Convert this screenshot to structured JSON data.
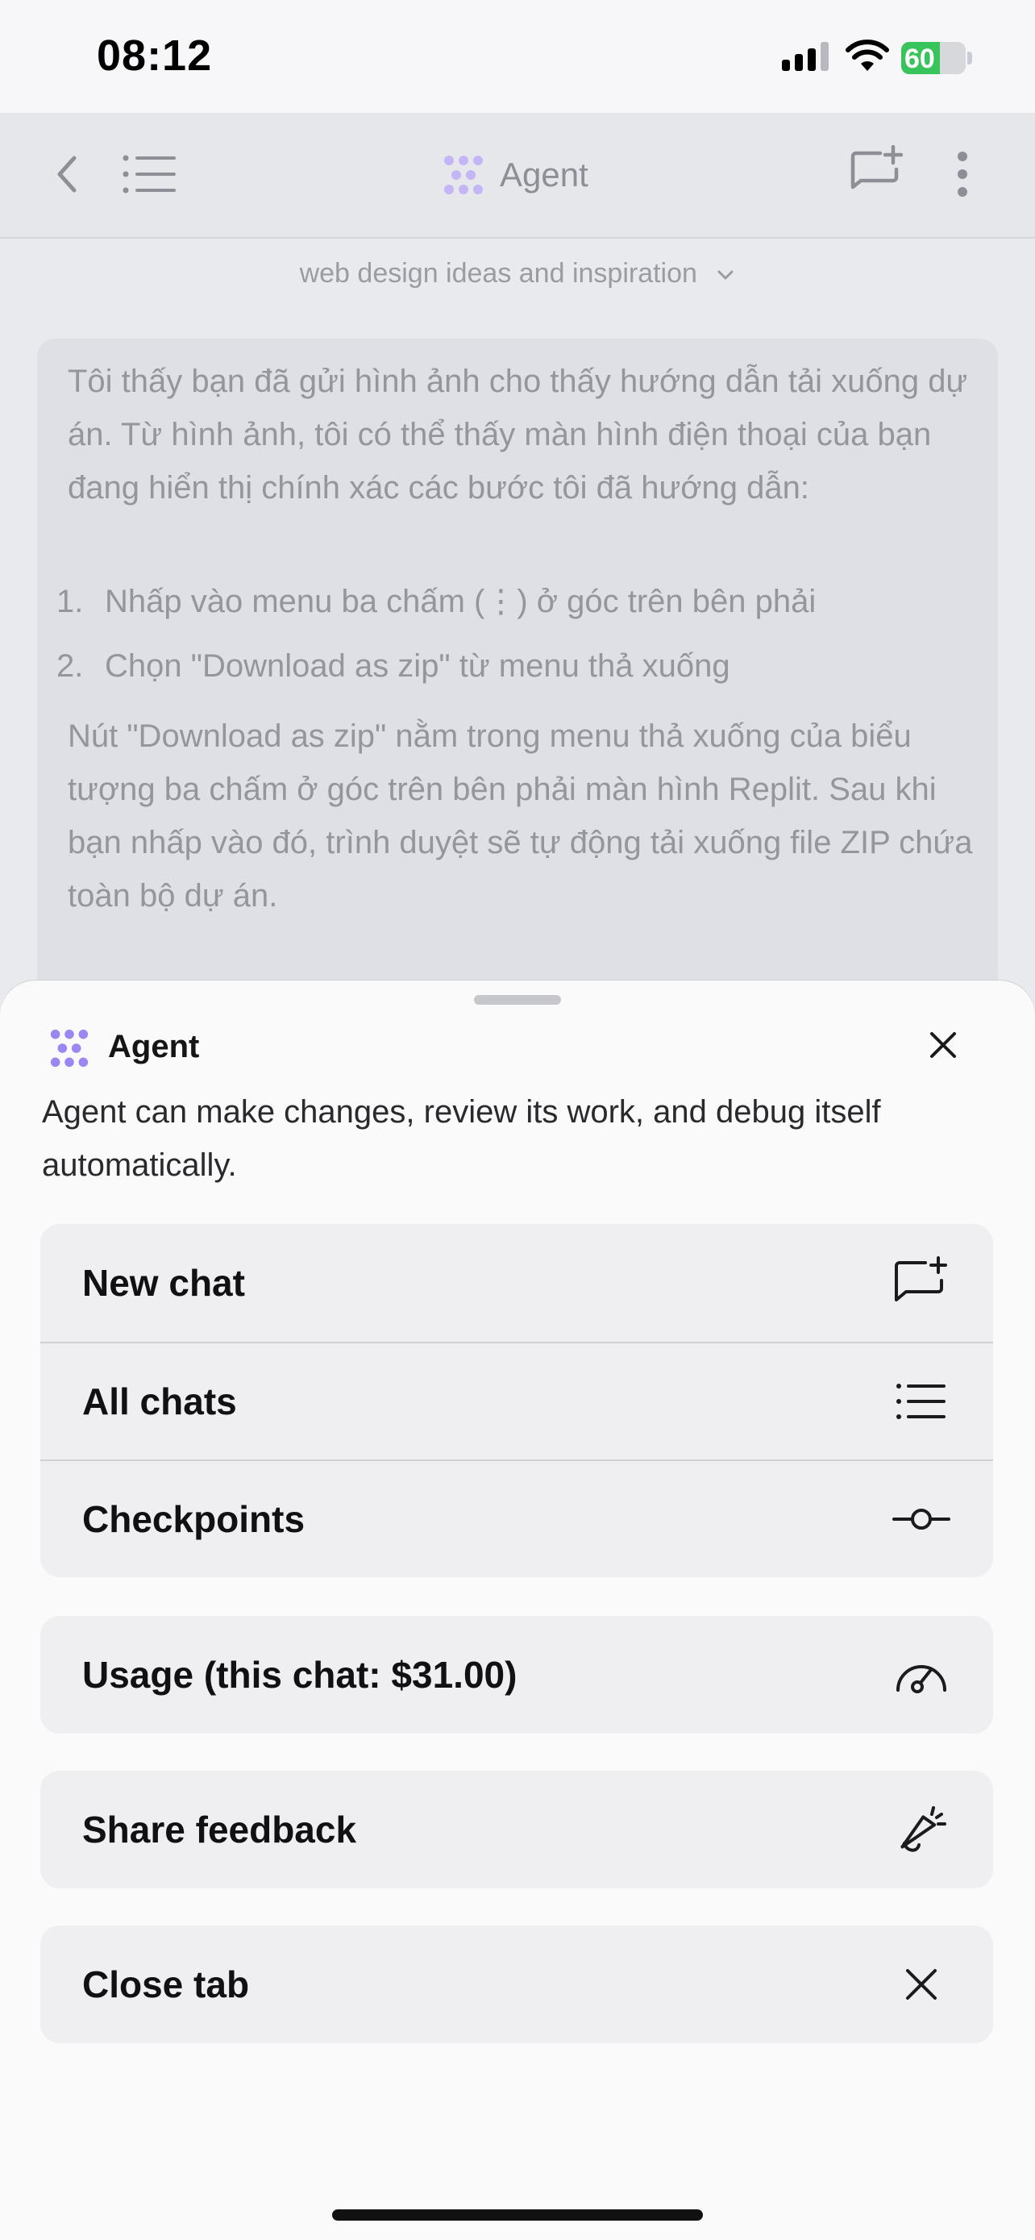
{
  "status_bar": {
    "time": "08:12",
    "battery": "60",
    "battery_level": 0.6
  },
  "header": {
    "title": "Agent"
  },
  "chat": {
    "session_title": "web design ideas and inspiration",
    "paragraph1": "Tôi thấy bạn đã gửi hình ảnh cho thấy hướng dẫn tải xuống dự án. Từ hình ảnh, tôi có thể thấy màn hình điện thoại của bạn đang hiển thị chính xác các bước tôi đã hướng dẫn:",
    "steps": [
      {
        "num": "1.",
        "text": "Nhấp vào menu ba chấm (⋮) ở góc trên bên phải"
      },
      {
        "num": "2.",
        "text": "Chọn \"Download as zip\" từ menu thả xuống"
      }
    ],
    "paragraph2": "Nút \"Download as zip\" nằm trong menu thả xuống của biểu tượng ba chấm ở góc trên bên phải màn hình Replit. Sau khi bạn nhấp vào đó, trình duyệt sẽ tự động tải xuống file ZIP chứa toàn bộ dự án."
  },
  "sheet": {
    "title": "Agent",
    "description": "Agent can make changes, review its work, and debug itself automatically.",
    "items": [
      {
        "label": "New chat",
        "icon": "new-chat-icon"
      },
      {
        "label": "All chats",
        "icon": "list-icon"
      },
      {
        "label": "Checkpoints",
        "icon": "checkpoint-icon"
      },
      {
        "label": "Usage (this chat: $31.00)",
        "icon": "gauge-icon"
      },
      {
        "label": "Share feedback",
        "icon": "megaphone-icon"
      },
      {
        "label": "Close tab",
        "icon": "close-icon"
      }
    ]
  },
  "colors": {
    "accent": "#9c86f2",
    "battery": "#39c45b"
  }
}
